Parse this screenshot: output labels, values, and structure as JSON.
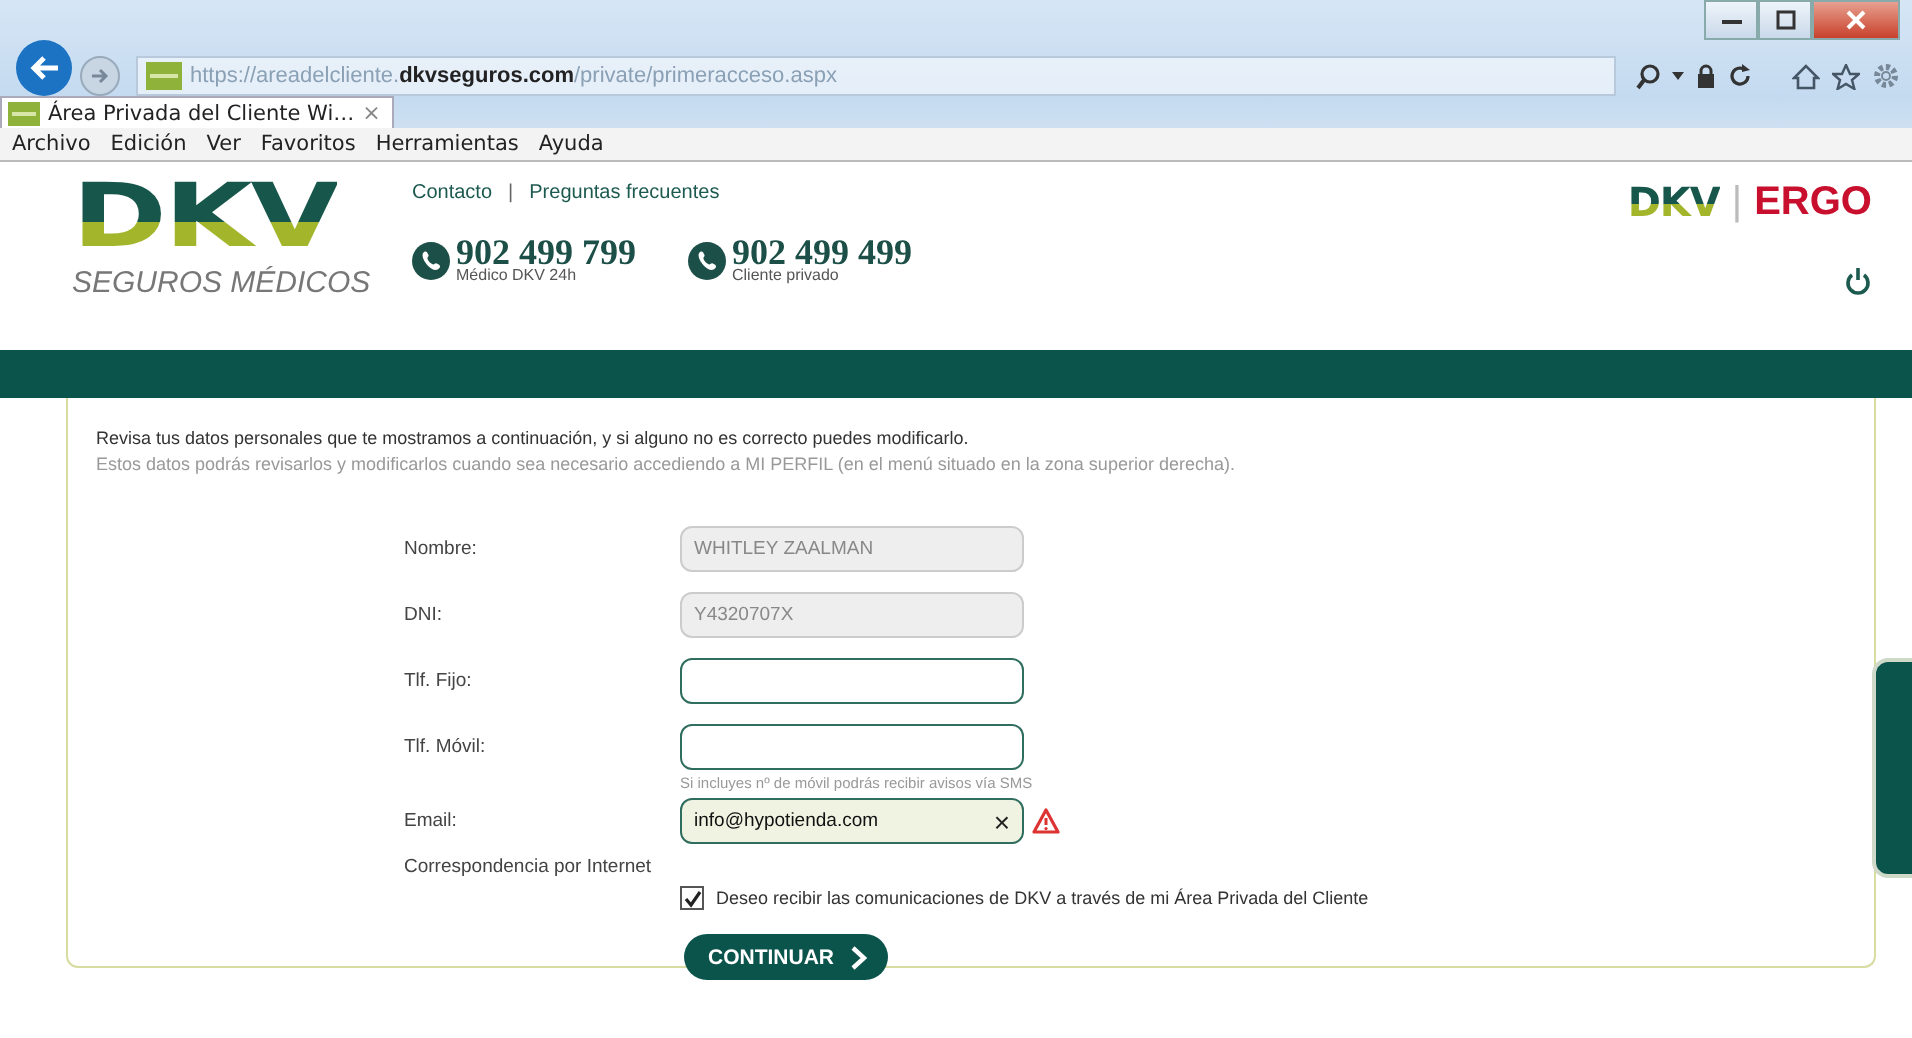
{
  "browser": {
    "url_host": "https://areadelcliente.",
    "url_domain": "dkvseguros.com",
    "url_path": "/private/primeracceso.aspx",
    "tabs": [
      {
        "label": "Área Privada del Cliente Wi…",
        "selected": true,
        "close": "×"
      }
    ],
    "menu": [
      "Archivo",
      "Edición",
      "Ver",
      "Favoritos",
      "Herramientas",
      "Ayuda"
    ]
  },
  "header": {
    "logo": "DKV",
    "logo_sub": "SEGUROS MÉDICOS",
    "links": [
      "Contacto",
      "Preguntas frecuentes"
    ],
    "separator": "|",
    "phones": [
      {
        "number": "902 499 799",
        "caption": "Médico DKV 24h"
      },
      {
        "number": "902 499 499",
        "caption": "Cliente privado"
      }
    ],
    "brand": "DKV",
    "brand_separator": "|",
    "partner": "ERGO"
  },
  "intro": [
    "Revisa tus datos personales que te mostramos a continuación, y si alguno no es correcto puedes modificarlo.",
    "Estos datos podrás revisarlos y modificarlos cuando sea necesario accediendo a MI PERFIL (en el menú situado en la zona superior derecha)."
  ],
  "form": {
    "fields": [
      {
        "label": "Nombre:",
        "value": "WHITLEY ZAALMAN",
        "disabled": true,
        "warning": false
      },
      {
        "label": "DNI:",
        "value": "Y4320707X",
        "disabled": true,
        "warning": false
      },
      {
        "label": "Tlf. Fijo:",
        "disabled": false,
        "warning": false
      },
      {
        "label": "Tlf. Móvil:",
        "disabled": false,
        "warning": false,
        "hint": "Si incluyes nº de móvil podrás recibir avisos vía SMS"
      },
      {
        "label": "Email:",
        "value": "info@hypotienda.com",
        "disabled": false,
        "warning": true,
        "clear": "×"
      }
    ],
    "consent": {
      "label": "Correspondencia por Internet",
      "text": "Deseo recibir las comunicaciones de DKV a través de mi Área Privada del Cliente",
      "checked": true
    },
    "submit": "CONTINUAR"
  }
}
